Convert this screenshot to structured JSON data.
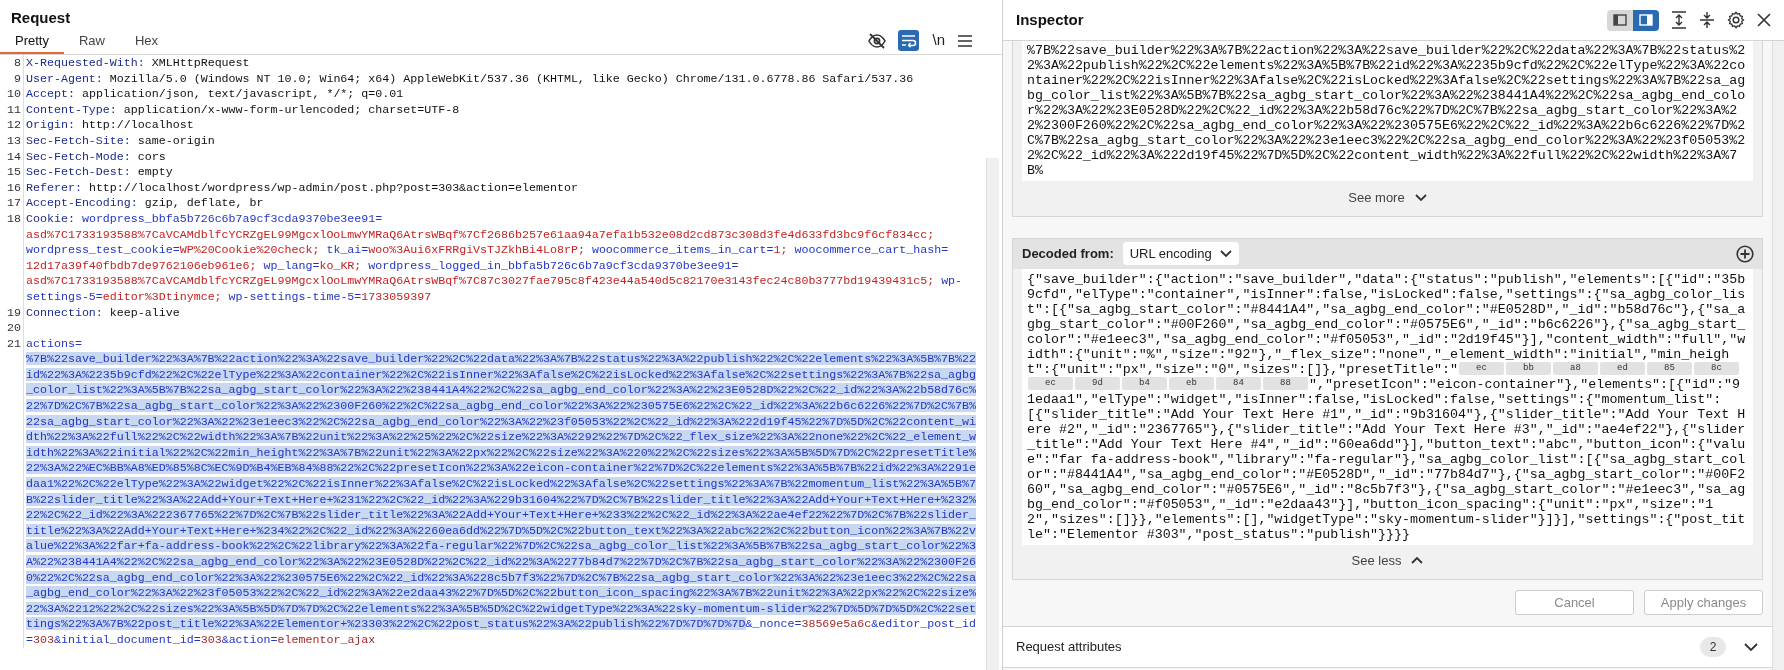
{
  "request": {
    "title": "Request",
    "tabs": [
      {
        "label": "Pretty",
        "selected": true
      },
      {
        "label": "Raw",
        "selected": false
      },
      {
        "label": "Hex",
        "selected": false
      }
    ],
    "toolbar": {
      "wrap_on": true,
      "newline_label": "\\n"
    }
  },
  "lines": [
    {
      "number": "8",
      "kind": "header",
      "name": "X-Requested-With:",
      "value": "XMLHttpRequest"
    },
    {
      "number": "9",
      "kind": "header",
      "name": "User-Agent:",
      "value": "Mozilla/5.0 (Windows NT 10.0; Win64; x64) AppleWebKit/537.36 (KHTML, like Gecko) Chrome/131.0.6778.86 Safari/537.36"
    },
    {
      "number": "10",
      "kind": "header",
      "name": "Accept:",
      "value": "application/json, text/javascript, */*; q=0.01"
    },
    {
      "number": "11",
      "kind": "header",
      "name": "Content-Type:",
      "value": "application/x-www-form-urlencoded; charset=UTF-8"
    },
    {
      "number": "12",
      "kind": "header",
      "name": "Origin:",
      "value": "http://localhost"
    },
    {
      "number": "13",
      "kind": "header",
      "name": "Sec-Fetch-Site:",
      "value": "same-origin"
    },
    {
      "number": "14",
      "kind": "header",
      "name": "Sec-Fetch-Mode:",
      "value": "cors"
    },
    {
      "number": "15",
      "kind": "header",
      "name": "Sec-Fetch-Dest:",
      "value": "empty"
    },
    {
      "number": "16",
      "kind": "header",
      "name": "Referer:",
      "value": "http://localhost/wordpress/wp-admin/post.php?post=303&action=elementor"
    },
    {
      "number": "17",
      "kind": "header",
      "name": "Accept-Encoding:",
      "value": "gzip, deflate, br"
    },
    {
      "number": "18",
      "kind": "cookie",
      "name": "Cookie:",
      "cookies": [
        {
          "name": "wordpress_bbfa5b726c6b7a9cf3cda9370be3ee91=",
          "value": "asd%7C1733193588%7CaVCAMdblfcYCRZgEL99MgcxlOoLmwYMRaQ6AtrsWBqf%7Cf2686b257e61aa94a7efa1b532e08d2cd873c308d3fe4d633fd3bc9f6cf834cc;"
        },
        {
          "name": "wordpress_test_cookie=",
          "value": "WP%20Cookie%20check;"
        },
        {
          "name": "tk_ai=",
          "value": "woo%3Aui6xFRRgiVsTJZkhBi4Lo8rP;"
        },
        {
          "name": "woocommerce_items_in_cart=",
          "value": "1;"
        },
        {
          "name": "woocommerce_cart_hash=",
          "value": "12d17a39f40fbdb7de9762106eb961e6;"
        },
        {
          "name": "wp_lang=",
          "value": "ko_KR;"
        },
        {
          "name": "wordpress_logged_in_bbfa5b726c6b7a9cf3cda9370be3ee91=",
          "value": "asd%7C1733193588%7CaVCAMdblfcYCRZgEL99MgcxlOoLmwYMRaQ6AtrsWBqf%7C87c3027fae795c8f423e44a540d5c82170e3143fec24c80b3777bd19439431c5;"
        },
        {
          "name": "wp-settings-5=",
          "value": "editor%3Dtinymce;"
        },
        {
          "name": "wp-settings-time-5=",
          "value": "1733059397"
        }
      ]
    },
    {
      "number": "19",
      "kind": "header",
      "name": "Connection:",
      "value": "keep-alive"
    },
    {
      "number": "20",
      "kind": "blank"
    },
    {
      "number": "21",
      "kind": "params",
      "params": [
        {
          "name": "actions=",
          "value": "%7B%22save_builder%22%3A%7B%22action%22%3A%22save_builder%22%2C%22data%22%3A%7B%22status%22%3A%22publish%22%2C%22elements%22%3A%5B%7B%22id%22%3A%2235b9cfd%22%2C%22elType%22%3A%22container%22%2C%22isInner%22%3Afalse%2C%22isLocked%22%3Afalse%2C%22settings%22%3A%7B%22sa_agbg_color_list%22%3A%5B%7B%22sa_agbg_start_color%22%3A%22%238441A4%22%2C%22sa_agbg_end_color%22%3A%22%23E0528D%22%2C%22_id%22%3A%22b58d76c%22%7D%2C%7B%22sa_agbg_start_color%22%3A%22%2300F260%22%2C%22sa_agbg_end_color%22%3A%22%230575E6%22%2C%22_id%22%3A%22b6c6226%22%7D%2C%7B%22sa_agbg_start_color%22%3A%22%23e1eec3%22%2C%22sa_agbg_end_color%22%3A%22%23f05053%22%2C%22_id%22%3A%222d19f45%22%7D%5D%2C%22content_width%22%3A%22full%22%2C%22width%22%3A%7B%22unit%22%3A%22%25%22%2C%22size%22%3A%2292%22%7D%2C%22_flex_size%22%3A%22none%22%2C%22_element_width%22%3A%22initial%22%2C%22min_height%22%3A%7B%22unit%22%3A%22px%22%2C%22size%22%3A%220%22%2C%22sizes%22%3A%5B%5D%7D%2C%22presetTitle%22%3A%22%EC%BB%A8%ED%85%8C%EC%9D%B4%EB%84%88%22%2C%22presetIcon%22%3A%22eicon-container%22%7D%2C%22elements%22%3A%5B%7B%22id%22%3A%2291edaa1%22%2C%22elType%22%3A%22widget%22%2C%22isInner%22%3Afalse%2C%22isLocked%22%3Afalse%2C%22settings%22%3A%7B%22momentum_list%22%3A%5B%7B%22slider_title%22%3A%22Add+Your+Text+Here+%231%22%2C%22_id%22%3A%229b31604%22%7D%2C%7B%22slider_title%22%3A%22Add+Your+Text+Here+%232%22%2C%22_id%22%3A%222367765%22%7D%2C%7B%22slider_title%22%3A%22Add+Your+Text+Here+%233%22%2C%22_id%22%3A%22ae4ef22%22%7D%2C%7B%22slider_title%22%3A%22Add+Your+Text+Here+%234%22%2C%22_id%22%3A%2260ea6dd%22%7D%5D%2C%22button_text%22%3A%22abc%22%2C%22button_icon%22%3A%7B%22value%22%3A%22far+fa-address-book%22%2C%22library%22%3A%22fa-regular%22%7D%2C%22sa_agbg_color_list%22%3A%5B%7B%22sa_agbg_start_color%22%3A%22%238441A4%22%2C%22sa_agbg_end_color%22%3A%22%23E0528D%22%2C%22_id%22%3A%2277b84d7%22%7D%2C%7B%22sa_agbg_start_color%22%3A%22%2300F260%22%2C%22sa_agbg_end_color%22%3A%22%230575E6%22%2C%22_id%22%3A%228c5b7f3%22%7D%2C%7B%22sa_agbg_start_color%22%3A%22%23e1eec3%22%2C%22sa_agbg_end_color%22%3A%22%23f05053%22%2C%22_id%22%3A%22e2daa43%22%7D%5D%2C%22button_icon_spacing%22%3A%7B%22unit%22%3A%22px%22%2C%22size%22%3A%2212%22%2C%22sizes%22%3A%5B%5D%7D%7D%2C%22elements%22%3A%5B%5D%2C%22widgetType%22%3A%22sky-momentum-slider%22%7D%5D%7D%5D%2C%22settings%22%3A%7B%22post_title%22%3A%22Elementor+%23303%22%2C%22post_status%22%3A%22publish%22%7D%7D%7D%7D",
          "selected": true
        },
        {
          "name": "&_nonce=",
          "value": "38569e5a6c",
          "selected": false
        },
        {
          "name": "&editor_post_id=",
          "value": "303",
          "selected": false
        },
        {
          "name": "&initial_document_id=",
          "value": "303",
          "selected": false
        },
        {
          "name": "&action=",
          "value": "elementor_ajax",
          "selected": false
        }
      ]
    }
  ],
  "inspector": {
    "title": "Inspector",
    "layout_buttons": [
      {
        "selected": false
      },
      {
        "selected": true
      }
    ],
    "encoded_value": "%7B%22save_builder%22%3A%7B%22action%22%3A%22save_builder%22%2C%22data%22%3A%7B%22status%22%3A%22publish%22%2C%22elements%22%3A%5B%7B%22id%22%3A%2235b9cfd%22%2C%22elType%22%3A%22container%22%2C%22isInner%22%3Afalse%2C%22isLocked%22%3Afalse%2C%22settings%22%3A%7B%22sa_agbg_color_list%22%3A%5B%7B%22sa_agbg_start_color%22%3A%22%238441A4%22%2C%22sa_agbg_end_color%22%3A%22%23E0528D%22%2C%22_id%22%3A%22b58d76c%22%7D%2C%7B%22sa_agbg_start_color%22%3A%22%2300F260%22%2C%22sa_agbg_end_color%22%3A%22%230575E6%22%2C%22_id%22%3A%22b6c6226%22%7D%2C%7B%22sa_agbg_start_color%22%3A%22%23e1eec3%22%2C%22sa_agbg_end_color%22%3A%22%23f05053%22%2C%22_id%22%3A%222d19f45%22%7D%5D%2C%22content_width%22%3A%22full%22%2C%22width%22%3A%7B%",
    "see_more": "See more",
    "decoder": {
      "label": "Decoded from:",
      "encoding": "URL encoding",
      "decoded_before": "{\"save_builder\":{\"action\":\"save_builder\",\"data\":{\"status\":\"publish\",\"elements\":[{\"id\":\"35b9cfd\",\"elType\":\"container\",\"isInner\":false,\"isLocked\":false,\"settings\":{\"sa_agbg_color_list\":[{\"sa_agbg_start_color\":\"#8441A4\",\"sa_agbg_end_color\":\"#E0528D\",\"_id\":\"b58d76c\"},{\"sa_agbg_start_color\":\"#00F260\",\"sa_agbg_end_color\":\"#0575E6\",\"_id\":\"b6c6226\"},{\"sa_agbg_start_color\":\"#e1eec3\",\"sa_agbg_end_color\":\"#f05053\",\"_id\":\"2d19f45\"}],\"content_width\":\"full\",\"width\":{\"unit\":\"%\",\"size\":\"92\"},\"_flex_size\":\"none\",\"_element_width\":\"initial\",\"min_height\":{\"unit\":\"px\",\"size\":\"0\",\"sizes\":[]},\"presetTitle\":\"",
      "bytes": [
        "ec",
        "bb",
        "a8",
        "ed",
        "85",
        "8c",
        "ec",
        "9d",
        "b4",
        "eb",
        "84",
        "88"
      ],
      "decoded_after": "\",\"presetIcon\":\"eicon-container\"},\"elements\":[{\"id\":\"91edaa1\",\"elType\":\"widget\",\"isInner\":false,\"isLocked\":false,\"settings\":{\"momentum_list\":[{\"slider_title\":\"Add Your Text Here #1\",\"_id\":\"9b31604\"},{\"slider_title\":\"Add Your Text Here #2\",\"_id\":\"2367765\"},{\"slider_title\":\"Add Your Text Here #3\",\"_id\":\"ae4ef22\"},{\"slider_title\":\"Add Your Text Here #4\",\"_id\":\"60ea6dd\"}],\"button_text\":\"abc\",\"button_icon\":{\"value\":\"far fa-address-book\",\"library\":\"fa-regular\"},\"sa_agbg_color_list\":[{\"sa_agbg_start_color\":\"#8441A4\",\"sa_agbg_end_color\":\"#E0528D\",\"_id\":\"77b84d7\"},{\"sa_agbg_start_color\":\"#00F260\",\"sa_agbg_end_color\":\"#0575E6\",\"_id\":\"8c5b7f3\"},{\"sa_agbg_start_color\":\"#e1eec3\",\"sa_agbg_end_color\":\"#f05053\",\"_id\":\"e2daa43\"}],\"button_icon_spacing\":{\"unit\":\"px\",\"size\":\"12\",\"sizes\":[]}},\"elements\":[],\"widgetType\":\"sky-momentum-slider\"}]}],\"settings\":{\"post_title\":\"Elementor #303\",\"post_status\":\"publish\"}}}}"
    },
    "see_less": "See less",
    "buttons": [
      {
        "label": "Cancel",
        "disabled": true
      },
      {
        "label": "Apply changes",
        "disabled": true
      }
    ],
    "attributes": {
      "label": "Request attributes",
      "count": "2",
      "expanded": false
    }
  }
}
